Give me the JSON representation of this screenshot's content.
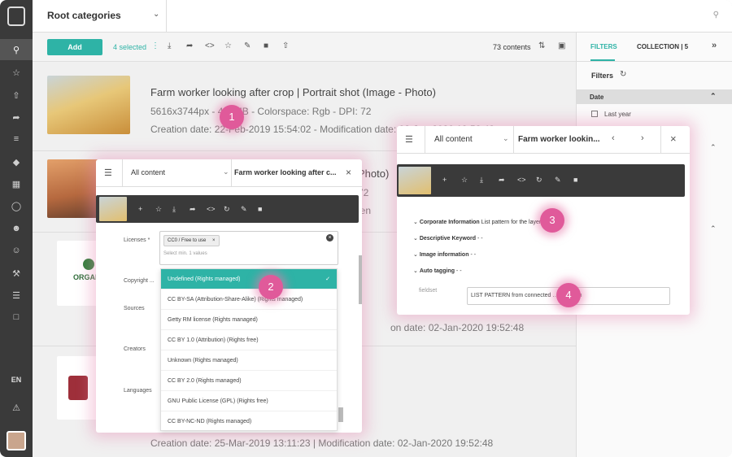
{
  "sidebar": {
    "lang": "EN"
  },
  "topbar": {
    "title": "Root categories"
  },
  "toolbar": {
    "add_label": "Add",
    "selected": "4 selected",
    "content_count": "73 contents"
  },
  "rows": [
    {
      "title": "Farm worker looking after crop | Portrait shot (Image - Photo)",
      "meta1": "5616x3744px - 4.7 MB - Colorspace: Rgb - DPI: 72",
      "meta2": "Creation date: 22-Feb-2019 15:54:02 - Modification date: 02-Jan-2020 19:52:48"
    },
    {
      "title_tail": "Photo)",
      "meta_tail": "72",
      "meta_tail2": "len"
    },
    {
      "meta2": "on date: 02-Jan-2020 19:52:48"
    },
    {
      "meta2": "Creation date: 25-Mar-2019 13:11:23 | Modification date: 02-Jan-2020 19:52:48"
    }
  ],
  "filters": {
    "tab_filters": "FILTERS",
    "tab_collection": "COLLECTION | 5",
    "heading": "Filters",
    "section": "Date",
    "option": "Last year"
  },
  "dialog1": {
    "select_label": "All content",
    "title": "Farm worker looking after c...",
    "licenses_label": "Licenses *",
    "tag": "CC0 / Free to use",
    "placeholder": "Select min. 1 values",
    "copyright_label": "Copyright ...",
    "sources_label": "Sources",
    "creators_label": "Creators",
    "languages_label": "Languages",
    "options": [
      "Undefined (Rights managed)",
      "CC BY-SA (Attribution-Share-Alike) (Rights managed)",
      "Getty RM license (Rights managed)",
      "CC BY 1.0 (Attribution) (Rights free)",
      "Unknown (Rights managed)",
      "CC BY 2.0 (Rights managed)",
      "GNU Public License (GPL) (Rights free)",
      "CC BY-NC-ND (Rights managed)"
    ]
  },
  "dialog2": {
    "select_label": "All content",
    "title": "Farm worker lookin...",
    "corp_label": "Corporate Information",
    "corp_value": "List pattern for the layer",
    "desc_label": "Descriptive Keyword",
    "desc_value": "- -",
    "img_label": "Image information",
    "img_value": "- -",
    "auto_label": "Auto tagging",
    "auto_value": "- -",
    "fieldset_label": "fieldset",
    "fieldset_value": "LIST PATTERN from connected … r relation"
  },
  "badges": [
    "1",
    "2",
    "3",
    "4"
  ],
  "logo_text": "ORGAN"
}
